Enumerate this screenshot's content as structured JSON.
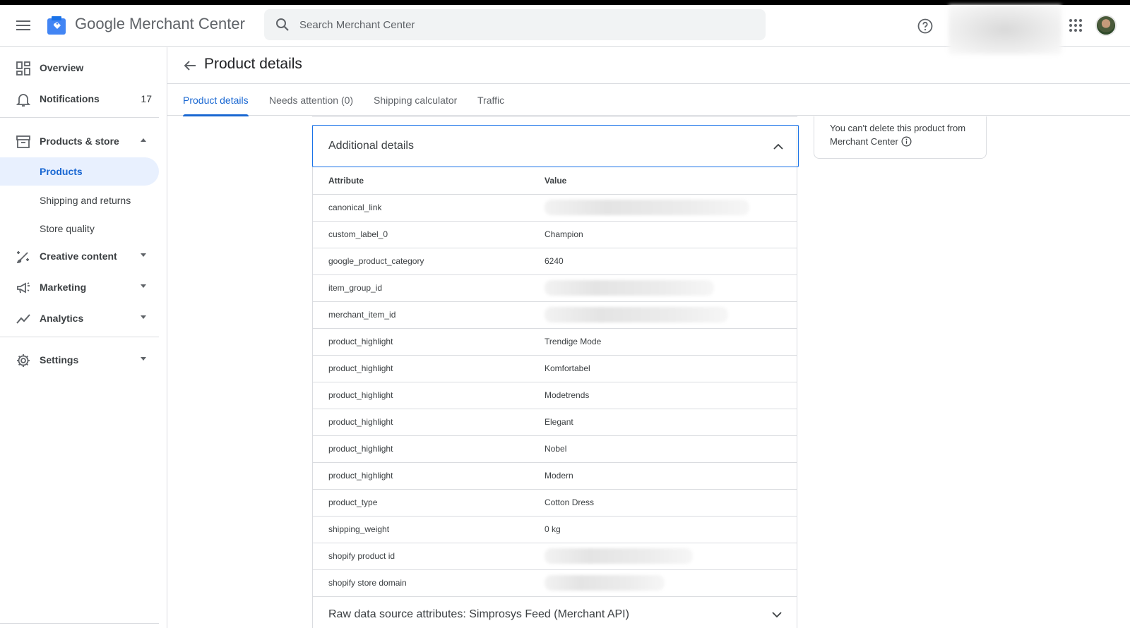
{
  "header": {
    "brand": "Google Merchant Center",
    "search_placeholder": "Search Merchant Center"
  },
  "sidebar": {
    "overview": "Overview",
    "notifications": "Notifications",
    "notifications_count": "17",
    "products_store": "Products & store",
    "sub_items": [
      "Products",
      "Shipping and returns",
      "Store quality"
    ],
    "creative_content": "Creative content",
    "marketing": "Marketing",
    "analytics": "Analytics",
    "settings": "Settings"
  },
  "page": {
    "title": "Product details",
    "tabs": [
      "Product details",
      "Needs attention (0)",
      "Shipping calculator",
      "Traffic"
    ]
  },
  "side_card": {
    "note": "You can't delete this product from Merchant Center"
  },
  "additional_details": {
    "title": "Additional details",
    "col_attribute": "Attribute",
    "col_value": "Value",
    "rows": [
      {
        "attribute": "canonical_link",
        "value": ""
      },
      {
        "attribute": "custom_label_0",
        "value": "Champion"
      },
      {
        "attribute": "google_product_category",
        "value": "6240"
      },
      {
        "attribute": "item_group_id",
        "value": ""
      },
      {
        "attribute": "merchant_item_id",
        "value": ""
      },
      {
        "attribute": "product_highlight",
        "value": "Trendige Mode"
      },
      {
        "attribute": "product_highlight",
        "value": "Komfortabel"
      },
      {
        "attribute": "product_highlight",
        "value": "Modetrends"
      },
      {
        "attribute": "product_highlight",
        "value": "Elegant"
      },
      {
        "attribute": "product_highlight",
        "value": "Nobel"
      },
      {
        "attribute": "product_highlight",
        "value": "Modern"
      },
      {
        "attribute": "product_type",
        "value": "Cotton Dress"
      },
      {
        "attribute": "shipping_weight",
        "value": "0 kg"
      },
      {
        "attribute": "shopify product id",
        "value": ""
      },
      {
        "attribute": "shopify store domain",
        "value": ""
      }
    ]
  },
  "raw_section": {
    "title": "Raw data source attributes: Simprosys Feed (Merchant API)"
  }
}
